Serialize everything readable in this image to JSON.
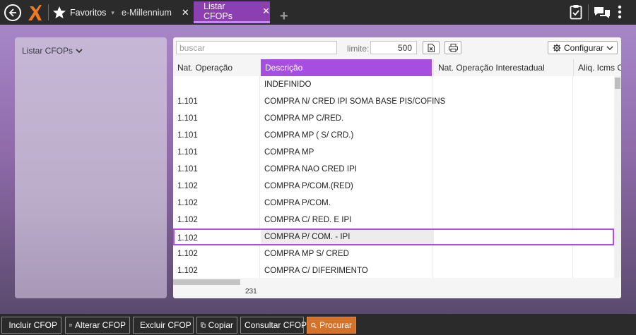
{
  "topbar": {
    "favorites_label": "Favoritos",
    "tabs": [
      {
        "label": "e-Millennium",
        "active": false
      },
      {
        "label": "Listar CFOPs",
        "active": true
      }
    ],
    "close_glyph": "✕",
    "add_glyph": "+",
    "caret_glyph": "▾"
  },
  "sidebar": {
    "title": "Listar CFOPs"
  },
  "toolbar": {
    "search_placeholder": "buscar",
    "limit_label": "limite:",
    "limit_value": "500",
    "config_label": "Configurar"
  },
  "grid": {
    "columns": [
      "Nat. Operação",
      "Descrição",
      "Nat. Operação Interestadual",
      "Aliq. Icms Cf"
    ],
    "rows": [
      {
        "nat": "",
        "desc": "INDEFINIDO"
      },
      {
        "nat": "1.101",
        "desc": "COMPRA N/ CRED IPI SOMA BASE PIS/COFINS"
      },
      {
        "nat": "1.101",
        "desc": "COMPRA MP C/RED."
      },
      {
        "nat": "1.101",
        "desc": "COMPRA MP ( S/ CRD.)"
      },
      {
        "nat": "1.101",
        "desc": "COMPRA MP"
      },
      {
        "nat": "1.101",
        "desc": "COMPRA NAO CRED IPI"
      },
      {
        "nat": "1.102",
        "desc": "COMPRA P/COM.(RED)"
      },
      {
        "nat": "1.102",
        "desc": "COMPRA P/COM."
      },
      {
        "nat": "1.102",
        "desc": "COMPRA C/ RED. E IPI"
      },
      {
        "nat": "1.102",
        "desc": "COMPRA P/ COM. - IPI",
        "selected": true
      },
      {
        "nat": "1.102",
        "desc": "COMPRA MP S/ CRED"
      },
      {
        "nat": "1.102",
        "desc": "COMPRA C/ DIFERIMENTO"
      }
    ],
    "record_count": "231"
  },
  "actions": {
    "incluir": "Incluir CFOP",
    "alterar": "Alterar CFOP",
    "excluir": "Excluir CFOP",
    "copiar": "Copiar",
    "consultar": "Consultar CFOP",
    "procurar": "Procurar"
  },
  "colors": {
    "accent": "#a64ee0",
    "tab_active": "#8c3fb0",
    "search_button": "#d4722c",
    "bar": "#2b2b2b"
  }
}
